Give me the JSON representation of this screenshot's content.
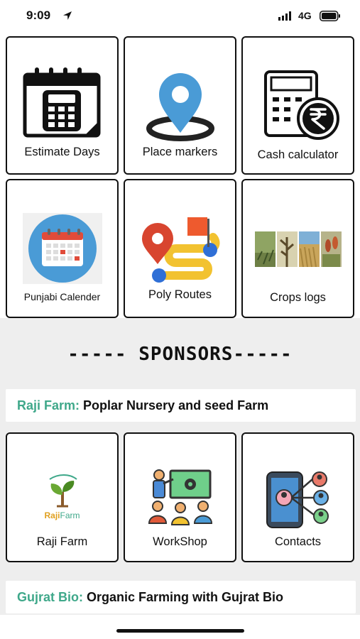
{
  "status_bar": {
    "time": "9:09",
    "network": "4G"
  },
  "tiles_top": [
    {
      "label": "Estimate Days",
      "icon": "calendar-calculator-icon"
    },
    {
      "label": "Place markers",
      "icon": "map-pin-icon"
    },
    {
      "label": "Cash calculator",
      "icon": "rupee-calculator-icon"
    },
    {
      "label": "Punjabi Calender",
      "icon": "calendar-icon"
    },
    {
      "label": "Poly Routes",
      "icon": "route-icon"
    },
    {
      "label": "Crops logs",
      "icon": "crops-photo-icon"
    }
  ],
  "sponsors": {
    "title": "----- SPONSORS-----",
    "banner1": {
      "brand": "Raji Farm:",
      "text": " Poplar Nursery and seed Farm"
    },
    "tiles": [
      {
        "label": "Raji Farm",
        "icon": "raji-farm-logo-icon",
        "logo_text_1": "Raji",
        "logo_text_2": "Farm"
      },
      {
        "label": "WorkShop",
        "icon": "workshop-icon"
      },
      {
        "label": "Contacts",
        "icon": "contacts-icon"
      }
    ],
    "banner2": {
      "brand": "Gujrat Bio:",
      "text": " Organic Farming with Gujrat Bio"
    }
  },
  "colors": {
    "accent_green": "#3fa88a",
    "pin_blue": "#4a9bd6",
    "route_red": "#e04b3a",
    "route_yellow": "#f2c230"
  }
}
